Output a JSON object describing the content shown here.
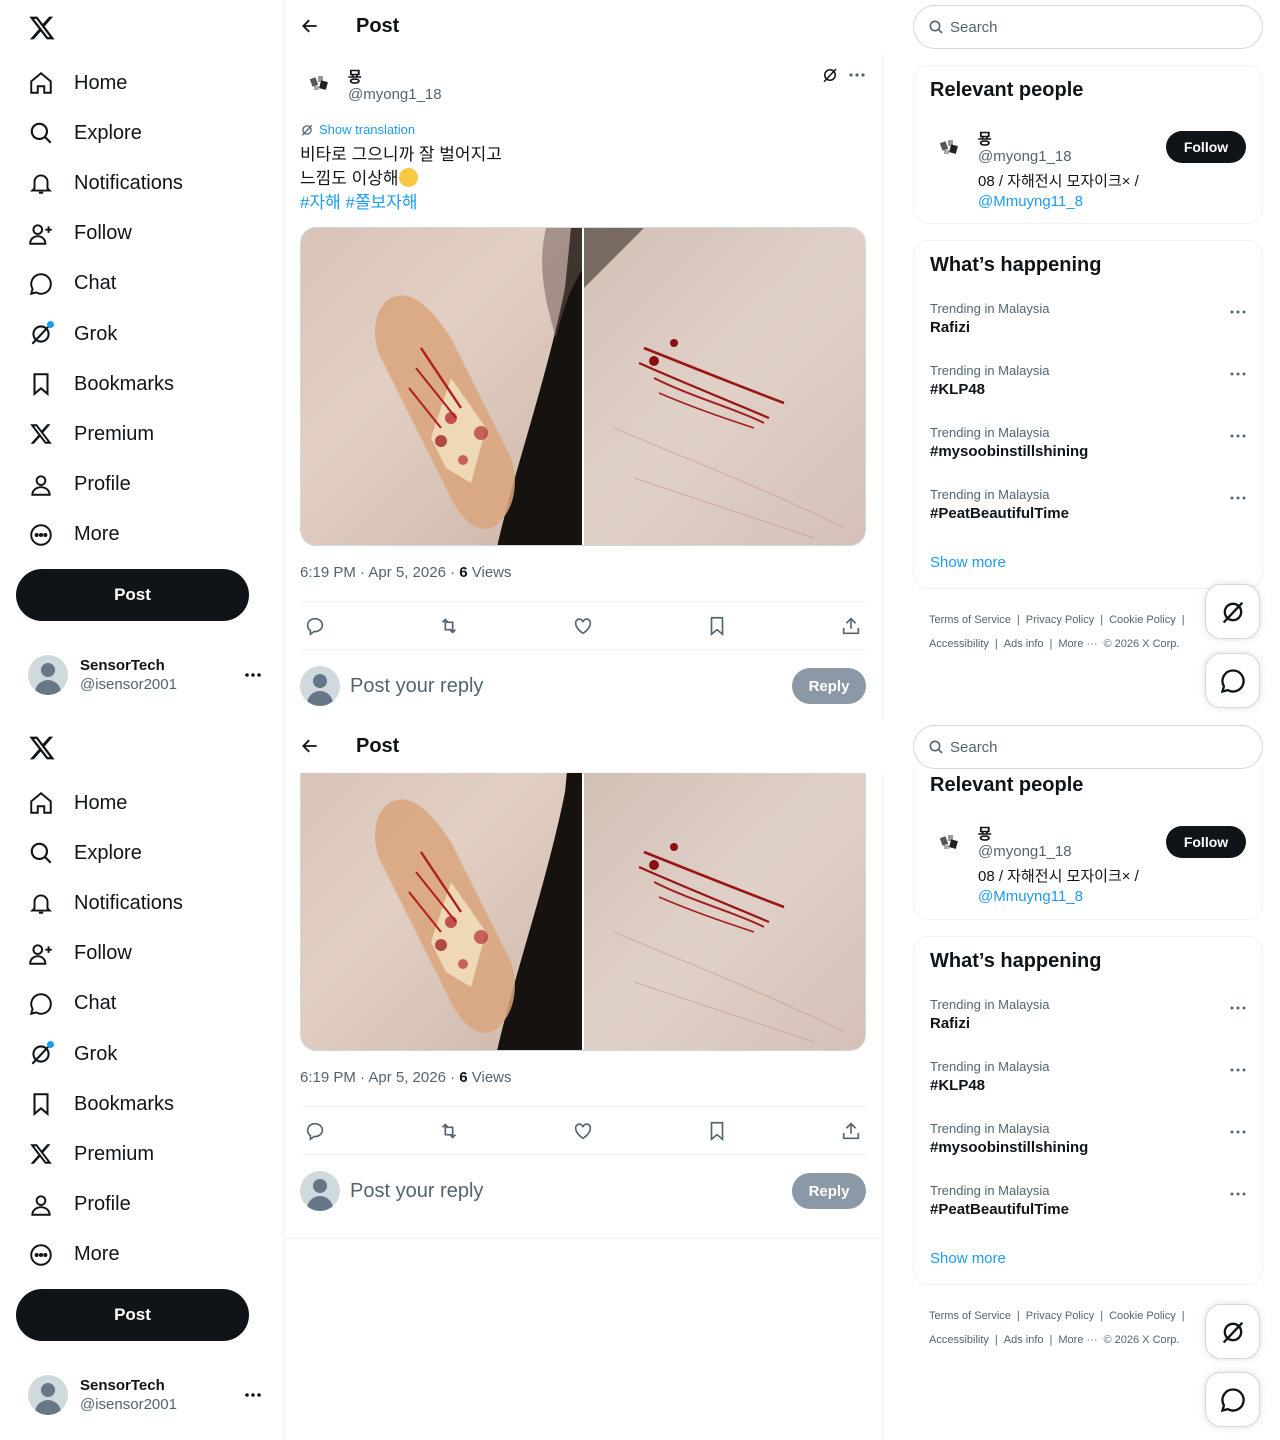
{
  "nav": {
    "items": [
      {
        "label": "Home",
        "icon": "home-icon"
      },
      {
        "label": "Explore",
        "icon": "search-icon"
      },
      {
        "label": "Notifications",
        "icon": "bell-icon"
      },
      {
        "label": "Follow",
        "icon": "add-person-icon"
      },
      {
        "label": "Chat",
        "icon": "chat-icon"
      },
      {
        "label": "Grok",
        "icon": "grok-icon"
      },
      {
        "label": "Bookmarks",
        "icon": "bookmark-icon"
      },
      {
        "label": "Premium",
        "icon": "x-logo-icon"
      },
      {
        "label": "Profile",
        "icon": "person-icon"
      },
      {
        "label": "More",
        "icon": "more-circle-icon"
      }
    ],
    "post_label": "Post"
  },
  "account": {
    "name": "SensorTech",
    "handle": "@isensor2001"
  },
  "header": {
    "title": "Post"
  },
  "tweet": {
    "author_name": "묭",
    "author_handle": "@myong1_18",
    "show_translation": "Show translation",
    "line1": "비타로 그으니까 잘 벌어지고",
    "line2": "느낌도 이상해",
    "hashtag1": "#자해",
    "hashtag2": "#쫄보자해",
    "time": "6:19 PM · Apr 5, 2026 · ",
    "views_count": "6",
    "views_label": " Views"
  },
  "reply": {
    "placeholder": "Post your reply",
    "button": "Reply"
  },
  "search": {
    "placeholder": "Search"
  },
  "relevant": {
    "title": "Relevant people",
    "name": "묭",
    "handle": "@myong1_18",
    "bio": "08 / 자해전시 모자이크× / ",
    "bio_link": "@Mmuyng11_8",
    "follow": "Follow"
  },
  "happening": {
    "title": "What’s happening",
    "trends": [
      {
        "context": "Trending in Malaysia",
        "topic": "Rafizi"
      },
      {
        "context": "Trending in Malaysia",
        "topic": "#KLP48"
      },
      {
        "context": "Trending in Malaysia",
        "topic": "#mysoobinstillshining"
      },
      {
        "context": "Trending in Malaysia",
        "topic": "#PeatBeautifulTime"
      }
    ],
    "show_more": "Show more"
  },
  "footer": {
    "links": [
      "Terms of Service",
      "|",
      "Privacy Policy",
      "|",
      "Cookie Policy",
      "|"
    ],
    "links2": [
      "Accessibility",
      "|",
      "Ads info",
      "|",
      "More ···",
      "© 2026 X Corp."
    ]
  },
  "colors": {
    "accent": "#1d9bf0",
    "text": "#0f1419",
    "muted": "#536471",
    "button_dark": "#0f1419",
    "reply_disabled": "#8b98a5"
  }
}
